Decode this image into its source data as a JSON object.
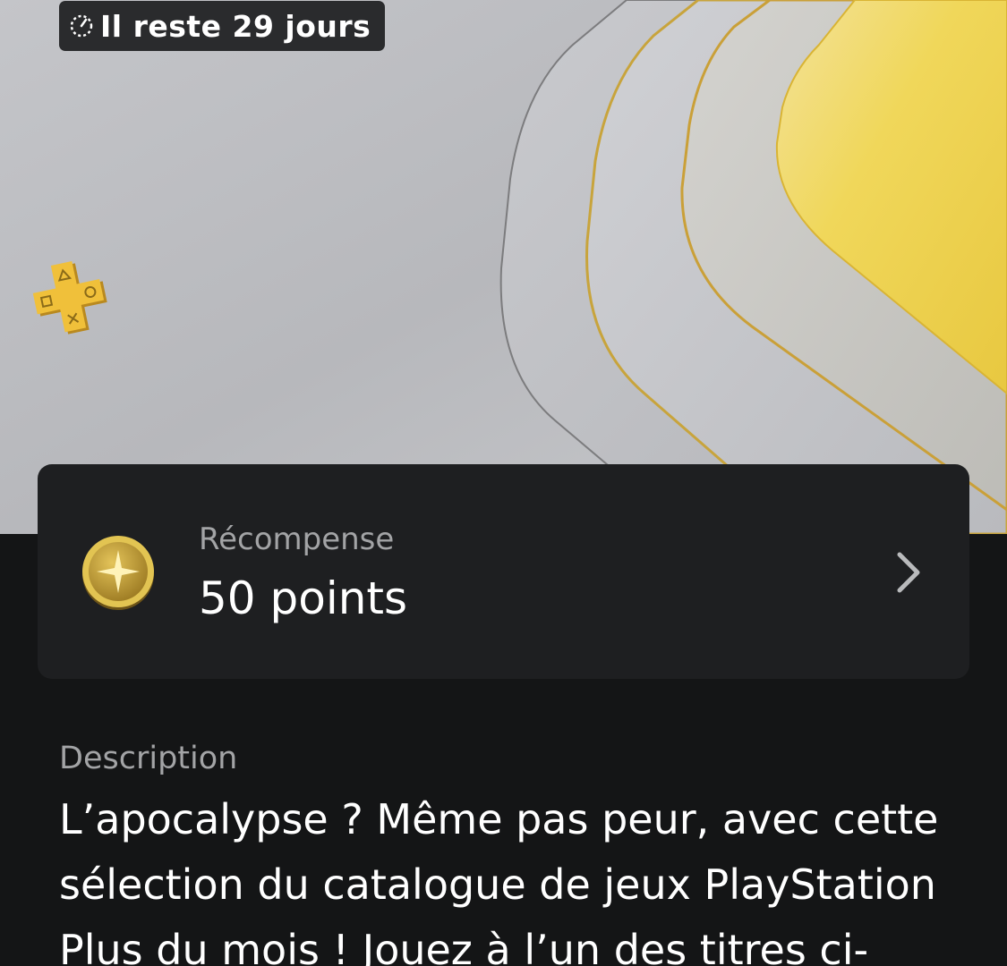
{
  "header": {
    "time_remaining": "Il reste 29 jours",
    "timer_icon": "timer-icon"
  },
  "banner": {
    "logo_icon": "playstation-plus-logo-icon",
    "accent_color": "#f2d24a"
  },
  "reward": {
    "label": "Récompense",
    "value": "50 points",
    "coin_icon": "gold-coin-star-icon",
    "chevron_icon": "chevron-right-icon"
  },
  "description": {
    "label": "Description",
    "text": "L’apocalypse ? Même pas peur, avec cette sélection du catalogue de jeux PlayStation Plus du mois ! Jouez à l’un des titres ci-"
  }
}
